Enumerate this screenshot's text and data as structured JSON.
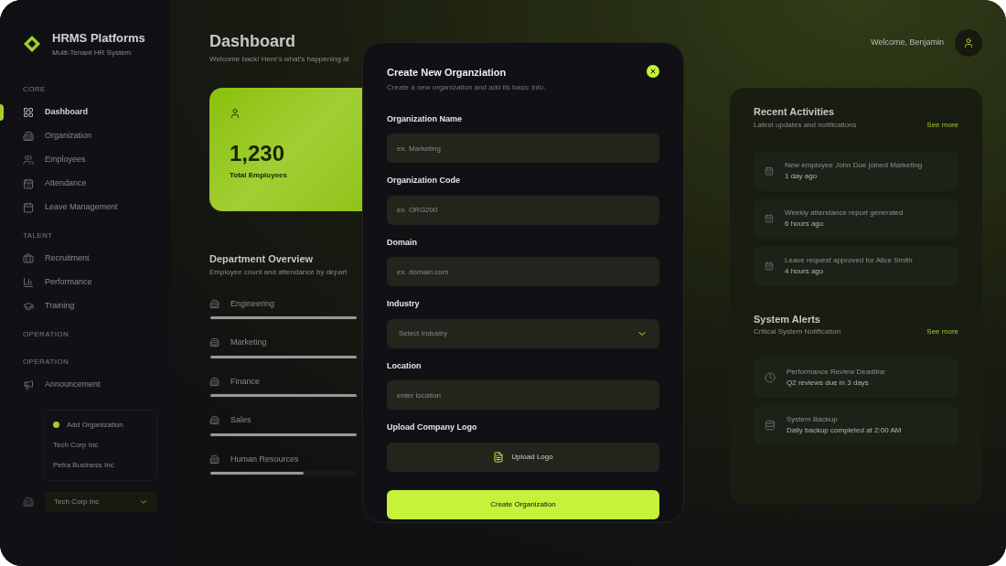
{
  "brand": {
    "title": "HRMS Platforms",
    "subtitle": "Multi-Tenant HR System"
  },
  "sidebar": {
    "sections": [
      {
        "heading": "CORE",
        "items": [
          {
            "label": "Dashboard",
            "selected": true
          },
          {
            "label": "Organization",
            "selected": false
          },
          {
            "label": "Employees",
            "selected": false
          },
          {
            "label": "Attendance",
            "selected": false
          },
          {
            "label": "Leave Management",
            "selected": false
          }
        ]
      },
      {
        "heading": "TALENT",
        "items": [
          {
            "label": "Recruitment",
            "selected": false
          },
          {
            "label": "Performance",
            "selected": false
          },
          {
            "label": "Training",
            "selected": false
          }
        ]
      },
      {
        "heading": "OPERATION"
      },
      {
        "heading": "OPERATION",
        "items": [
          {
            "label": "Announcement",
            "selected": false
          }
        ]
      }
    ]
  },
  "org_menu": {
    "options": [
      {
        "label": "Add Organization",
        "kind": "add"
      },
      {
        "label": "Tech Corp Inc",
        "kind": "org"
      },
      {
        "label": "Petra Business Inc",
        "kind": "org"
      }
    ]
  },
  "org_select": {
    "value": "Tech Corp Inc"
  },
  "header": {
    "title": "Dashboard",
    "subtitle": "Welcome back! Here's what's happening at",
    "welcome": "Welcome, Benjamin"
  },
  "stat_card": {
    "value": "1,230",
    "label": "Total Employees"
  },
  "department_overview": {
    "title": "Department Overview",
    "subtitle": "Employee count and attendance by depart",
    "departments": [
      {
        "name": "Engineering",
        "level": 1
      },
      {
        "name": "Marketing",
        "level": 1
      },
      {
        "name": "Finance",
        "level": 1
      },
      {
        "name": "Sales",
        "level": 1
      },
      {
        "name": "Human Resources",
        "level": 0.64
      }
    ]
  },
  "recent_activities": {
    "title": "Recent Activities",
    "subtitle": "Latest updates and notifications",
    "link": "See more",
    "items": [
      {
        "text": "New employee John Doe joined Marketing",
        "time": "1 day ago"
      },
      {
        "text": "Weekly attendance report generated",
        "time": "6 hours ago"
      },
      {
        "text": "Leave request approved for Alice Smith",
        "time": "4 hours ago"
      }
    ]
  },
  "system_alerts": {
    "title": "System Alerts",
    "subtitle": "Critical System Notification",
    "link": "See more",
    "items": [
      {
        "text": "Performance Review Deadline",
        "time": "Q2 reviews due in 3 days",
        "kind": "clock"
      },
      {
        "text": "System Backup",
        "time": "Daily backup completed at 2:00 AM",
        "kind": "backup"
      }
    ]
  },
  "modal": {
    "title": "Create New Organziation",
    "subtitle": "Create a new organization and add its basic Info.",
    "fields": [
      {
        "label": "Organization Name",
        "kind": "text",
        "placeholder": "ex. Marketing"
      },
      {
        "label": "Organization Code",
        "kind": "text",
        "placeholder": "ex. ORG200"
      },
      {
        "label": "Domain",
        "kind": "text",
        "placeholder": "ex. domain.com"
      },
      {
        "label": "Industry",
        "kind": "select",
        "placeholder": "Select Industry"
      },
      {
        "label": "Location",
        "kind": "text",
        "placeholder": "enter location"
      },
      {
        "label": "Upload Company Logo",
        "kind": "upload",
        "placeholder": "Upload Logo"
      }
    ],
    "submit": "Create Organization"
  }
}
